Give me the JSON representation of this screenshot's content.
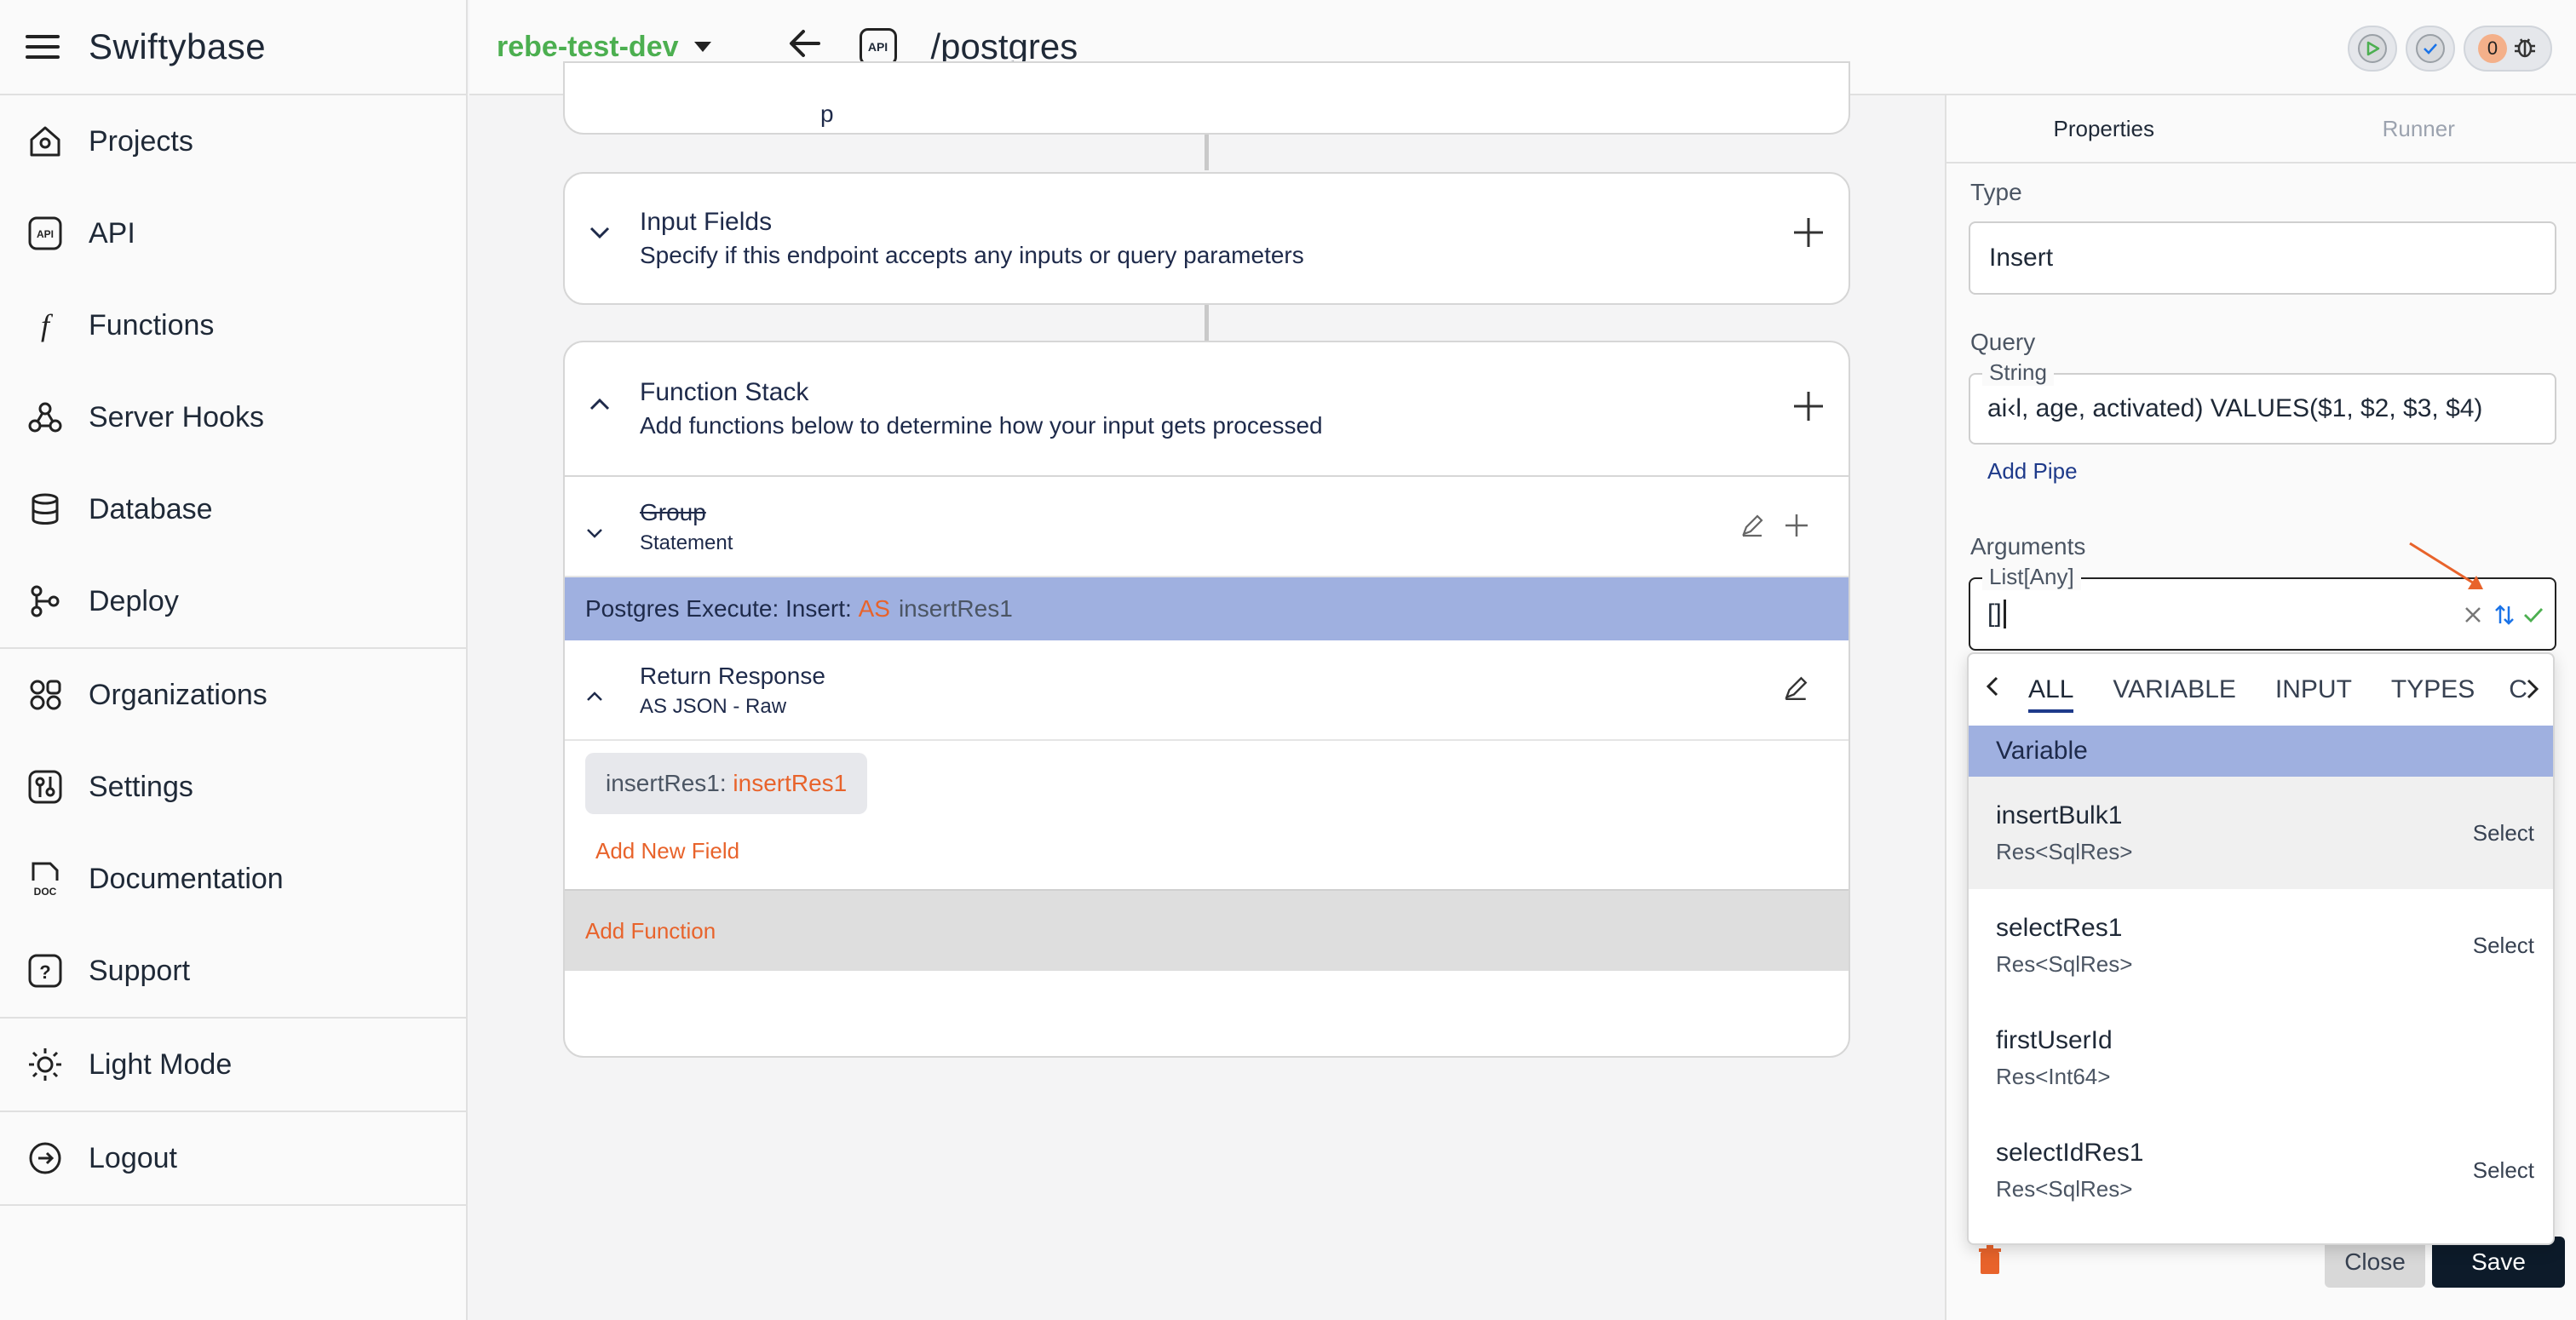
{
  "app": {
    "name": "Swiftybase"
  },
  "sidebar": {
    "groups": [
      [
        {
          "label": "Projects",
          "icon": "projects-icon"
        },
        {
          "label": "API",
          "icon": "api-icon"
        },
        {
          "label": "Functions",
          "icon": "function-icon"
        },
        {
          "label": "Server Hooks",
          "icon": "hooks-icon"
        },
        {
          "label": "Database",
          "icon": "database-icon"
        },
        {
          "label": "Deploy",
          "icon": "deploy-icon"
        }
      ],
      [
        {
          "label": "Organizations",
          "icon": "organizations-icon"
        },
        {
          "label": "Settings",
          "icon": "settings-icon"
        },
        {
          "label": "Documentation",
          "icon": "documentation-icon"
        },
        {
          "label": "Support",
          "icon": "support-icon"
        }
      ],
      [
        {
          "label": "Light Mode",
          "icon": "sun-icon"
        }
      ],
      [
        {
          "label": "Logout",
          "icon": "logout-icon"
        }
      ]
    ]
  },
  "topbar": {
    "environment": "rebe-test-dev",
    "api_badge": "API",
    "route": "/postgres",
    "error_count": "0"
  },
  "canvas": {
    "input_fields": {
      "title": "Input Fields",
      "subtitle": "Specify if this endpoint accepts any inputs or query parameters"
    },
    "function_stack": {
      "title": "Function Stack",
      "subtitle": "Add functions below to determine how your input gets processed"
    },
    "group": {
      "title": "Group",
      "subtitle": "Statement"
    },
    "postgres_row": {
      "prefix": "Postgres Execute: Insert: ",
      "as": "AS",
      "var": "insertRes1"
    },
    "return_response": {
      "title": "Return Response",
      "subtitle": "AS JSON - Raw"
    },
    "response_field": {
      "key": "insertRes1",
      "sep": ": ",
      "value": "insertRes1"
    },
    "add_new_field": "Add New Field",
    "add_function": "Add Function"
  },
  "panel": {
    "tabs": [
      "Properties",
      "Runner"
    ],
    "type_label": "Type",
    "type_value": "Insert",
    "query_label": "Query",
    "query_legend": "String",
    "query_value": "ai‹l, age, activated) VALUES($1, $2, $3, $4)",
    "add_pipe": "Add Pipe",
    "arguments_label": "Arguments",
    "arguments_legend": "List[Any]",
    "arguments_value": "[]",
    "close": "Close",
    "save": "Save"
  },
  "dropdown": {
    "tabs": [
      "ALL",
      "VARIABLE",
      "INPUT",
      "TYPES",
      "C"
    ],
    "header": "Variable",
    "select_label": "Select",
    "items": [
      {
        "name": "insertBulk1",
        "type": "Res<SqlRes>",
        "selectable": true
      },
      {
        "name": "selectRes1",
        "type": "Res<SqlRes>",
        "selectable": true
      },
      {
        "name": "firstUserId",
        "type": "Res<Int64>",
        "selectable": false
      },
      {
        "name": "selectIdRes1",
        "type": "Res<SqlRes>",
        "selectable": true
      }
    ]
  },
  "colors": {
    "accent": "#e8632b",
    "env_green": "#4caf50",
    "highlight": "#9fb0e0",
    "save_bg": "#0d1b2a"
  }
}
